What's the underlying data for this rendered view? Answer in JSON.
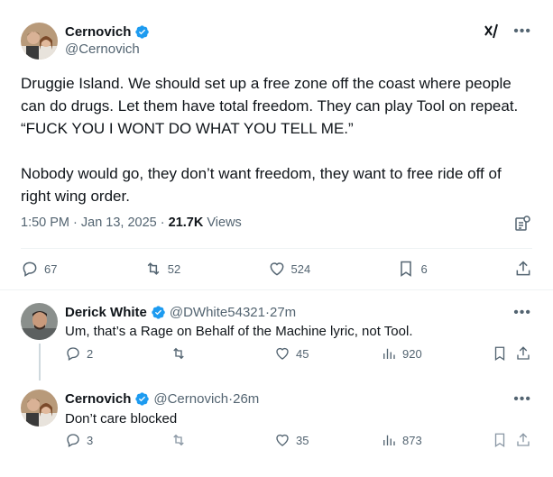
{
  "main_tweet": {
    "author_name": "Cernovich",
    "author_handle": "@Cernovich",
    "text": "Druggie Island. We should set up a free zone off the coast where people can do drugs. Let them have total freedom. They can play Tool on repeat. “FUCK YOU I WONT DO WHAT YOU TELL ME.”\n\nNobody would go, they don’t want freedom, they want to free ride off of right wing order.",
    "time": "1:50 PM",
    "date": "Jan 13, 2025",
    "views_count": "21.7K",
    "views_label": "Views",
    "replies": "67",
    "retweets": "52",
    "likes": "524",
    "bookmarks": "6"
  },
  "replies": [
    {
      "author_name": "Derick White",
      "author_handle": "@DWhite54321",
      "time_ago": "27m",
      "text": "Um, that’s a Rage on Behalf of the Machine lyric, not Tool.",
      "replies": "2",
      "retweets": "",
      "likes": "45",
      "views": "920"
    },
    {
      "author_name": "Cernovich",
      "author_handle": "@Cernovich",
      "time_ago": "26m",
      "text": "Don’t care blocked",
      "replies": "3",
      "retweets": "",
      "likes": "35",
      "views": "873"
    }
  ],
  "separator": " · ",
  "colors": {
    "verified": "#1d9bf0",
    "text_primary": "#0f1419",
    "text_secondary": "#536471",
    "border": "#eff3f4"
  },
  "icons": [
    "verified-badge-icon",
    "grok-icon",
    "more-icon",
    "bookmark-analytics-icon",
    "reply-icon",
    "retweet-icon",
    "like-icon",
    "bookmark-icon",
    "share-icon",
    "views-icon"
  ]
}
